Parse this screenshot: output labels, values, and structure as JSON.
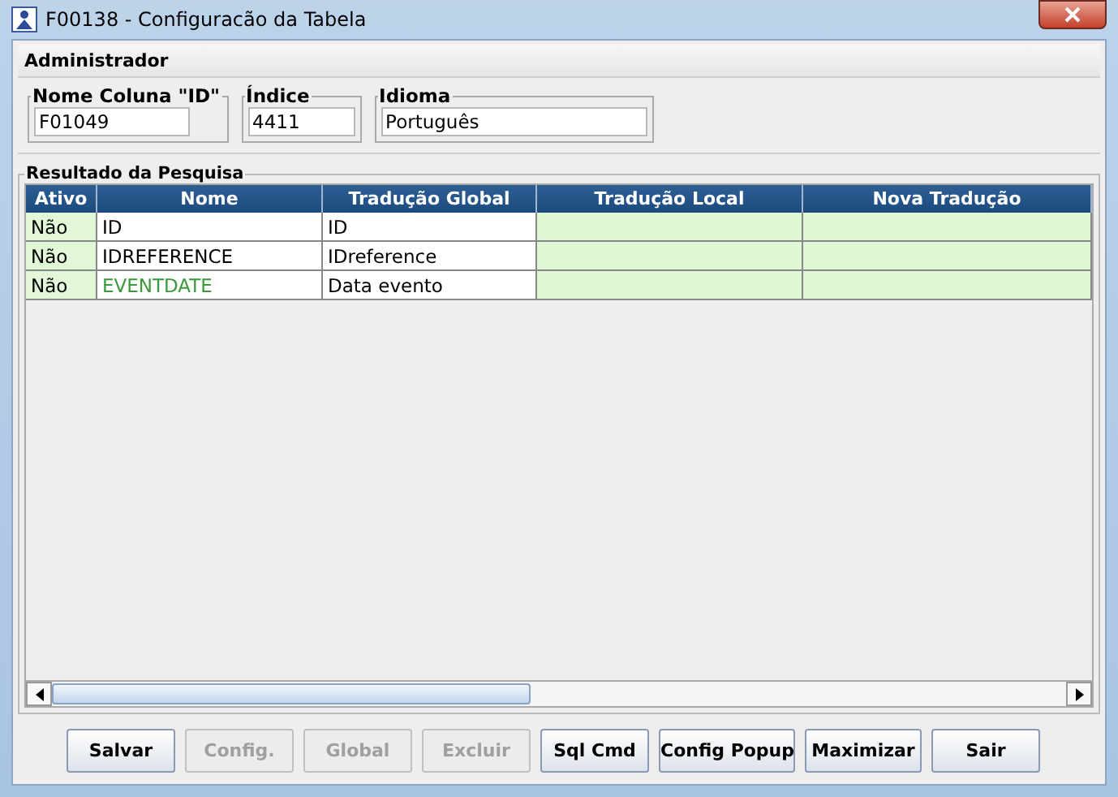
{
  "window": {
    "title": "F00138 - Configuracão da Tabela"
  },
  "header": {
    "title": "Administrador"
  },
  "fields": [
    {
      "label": "Nome Coluna \"ID\"",
      "value": "F01049"
    },
    {
      "label": "Índice",
      "value": "4411"
    },
    {
      "label": "Idioma",
      "value": "Português"
    }
  ],
  "results": {
    "title": "Resultado da Pesquisa",
    "columns": [
      "Ativo",
      "Nome",
      "Tradução Global",
      "Tradução Local",
      "Nova Tradução"
    ],
    "rows": [
      {
        "ativo": "Não",
        "nome": "ID",
        "color": "#000000",
        "global": "ID"
      },
      {
        "ativo": "Não",
        "nome": "IDREFERENCE",
        "color": "#000000",
        "global": "IDreference"
      },
      {
        "ativo": "Não",
        "nome": "EVENTDATE",
        "color": "#3a9a3a",
        "global": "Data evento"
      }
    ]
  },
  "buttons": [
    {
      "label": "Salvar",
      "disabled": false
    },
    {
      "label": "Config.",
      "disabled": true
    },
    {
      "label": "Global",
      "disabled": true
    },
    {
      "label": "Excluir",
      "disabled": true
    },
    {
      "label": "Sql Cmd",
      "disabled": false
    },
    {
      "label": "Config Popup",
      "disabled": false
    },
    {
      "label": "Maximizar",
      "disabled": false
    },
    {
      "label": "Sair",
      "disabled": false
    }
  ]
}
